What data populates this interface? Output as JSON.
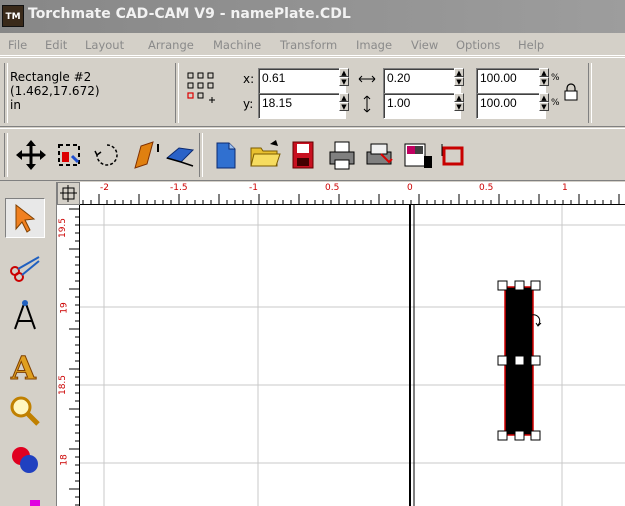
{
  "window": {
    "title": "Torchmate CAD-CAM V9 - namePlate.CDL",
    "icon_text": "TM"
  },
  "menu": [
    "File",
    "Edit",
    "Layout",
    "Arrange",
    "Machine",
    "Transform",
    "Image",
    "View",
    "Options",
    "Help"
  ],
  "object_info": {
    "name": "Rectangle #2",
    "coords": "(1.462,17.672)",
    "units": "in"
  },
  "fields": {
    "x_label": "x:",
    "x_value": "0.61",
    "y_label": "y:",
    "y_value": "18.15",
    "width_value": "0.20",
    "height_value": "1.00",
    "scale_x_value": "100.00",
    "scale_y_value": "100.00",
    "percent": "%"
  },
  "icons": {
    "toolbar": [
      "move-icon",
      "select-frame-icon",
      "rotate-icon",
      "skew-icon",
      "mirror-icon",
      "new-document-icon",
      "open-folder-icon",
      "save-icon",
      "print-icon",
      "export-icon",
      "import-icon",
      "undo-icon"
    ],
    "toolbox": [
      "pointer-icon",
      "scissors-icon",
      "node-edit-icon",
      "text-icon",
      "zoom-icon",
      "shapes-icon"
    ]
  },
  "rulers": {
    "horizontal_labels": [
      "-2",
      "-1.5",
      "-1",
      "0.5",
      "0",
      "0.5",
      "1"
    ],
    "vertical_labels": [
      "19.5",
      "19",
      "18.5",
      "18"
    ]
  },
  "colors": {
    "selection_outline": "#d00000",
    "shape_fill": "#000000",
    "grid": "#c0c0c0"
  }
}
